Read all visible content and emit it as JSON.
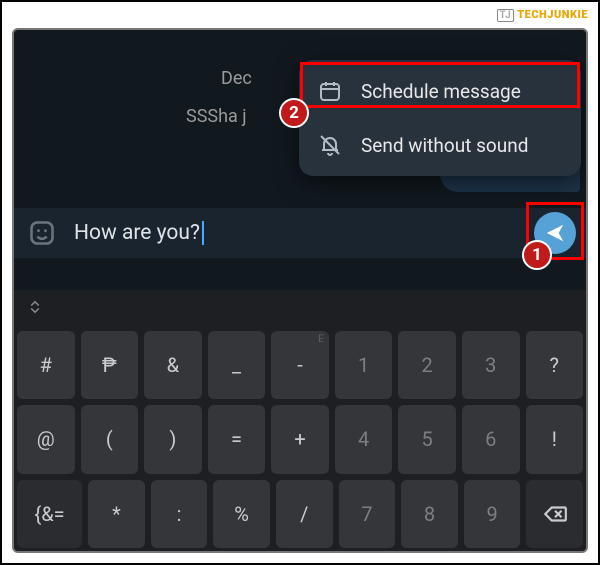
{
  "watermark": {
    "logo": "TJ",
    "name": "TECHJUNKIE"
  },
  "chat": {
    "date_label": "Dec",
    "name_fragment": "SSSha j"
  },
  "popup": {
    "schedule_label": "Schedule message",
    "silent_label": "Send without sound"
  },
  "callouts": {
    "badge1": "1",
    "badge2": "2"
  },
  "compose": {
    "text": "How are you?"
  },
  "keyboard": {
    "row1": [
      {
        "main": "#",
        "sup": ""
      },
      {
        "main": "₱",
        "sup": ""
      },
      {
        "main": "&",
        "sup": ""
      },
      {
        "main": "_",
        "sup": ""
      },
      {
        "main": "-",
        "sup": "E"
      },
      {
        "main": "1",
        "sup": ""
      },
      {
        "main": "2",
        "sup": ""
      },
      {
        "main": "3",
        "sup": ""
      },
      {
        "main": "?",
        "sup": ""
      }
    ],
    "row2": [
      {
        "main": "@",
        "sup": ""
      },
      {
        "main": "(",
        "sup": ""
      },
      {
        "main": ")",
        "sup": ""
      },
      {
        "main": "=",
        "sup": ""
      },
      {
        "main": "+",
        "sup": ""
      },
      {
        "main": "4",
        "sup": ""
      },
      {
        "main": "5",
        "sup": ""
      },
      {
        "main": "6",
        "sup": ""
      },
      {
        "main": "!",
        "sup": ""
      }
    ],
    "row3": [
      {
        "main": "{&=",
        "func": true
      },
      {
        "main": "*",
        "sup": ""
      },
      {
        "main": ":",
        "sup": ""
      },
      {
        "main": "%",
        "sup": ""
      },
      {
        "main": "/",
        "sup": ""
      },
      {
        "main": "7",
        "sup": ""
      },
      {
        "main": "8",
        "sup": ""
      },
      {
        "main": "9",
        "sup": ""
      },
      {
        "main": "__bksp__",
        "func": true
      }
    ]
  }
}
